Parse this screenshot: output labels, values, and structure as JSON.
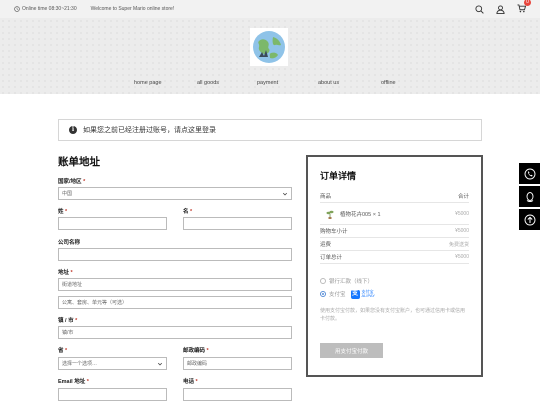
{
  "topbar": {
    "online_time": "Online time 08:30~21:30",
    "welcome": "Welcome to Super Mario online store!",
    "cart_count": "0"
  },
  "nav": {
    "home": "home page",
    "goods": "all goods",
    "payment": "payment",
    "about": "about us",
    "offline": "offline"
  },
  "notice": {
    "text": "如果您之前已经注册过账号，请点这里登录"
  },
  "billing": {
    "title": "账单地址",
    "country_label": "国家/地区",
    "country_value": "中国",
    "last_name_label": "姓",
    "first_name_label": "名",
    "company_label": "公司名称",
    "address_label": "地址",
    "address1_placeholder": "街道地址",
    "address2_placeholder": "公寓、套房、单元等（可选）",
    "city_label": "镇 / 市",
    "city_placeholder": "镇/市",
    "state_label": "省",
    "state_value": "选择一个选项…",
    "postcode_label": "邮政编码",
    "postcode_placeholder": "邮政编码",
    "email_label": "Email 地址",
    "phone_label": "电话",
    "required_mark": "*"
  },
  "order": {
    "title": "订单详情",
    "col_product": "商品",
    "col_total": "合计",
    "product_name": "植物花卉005 × 1",
    "product_price": "¥5000",
    "subtotal_label": "购物车小计",
    "subtotal_value": "¥5000",
    "shipping_label": "运费",
    "shipping_value": "免费送货",
    "total_label": "订单总计",
    "total_value": "¥5000",
    "pay_bank": "银行汇款（线下）",
    "pay_alipay": "支付宝",
    "alipay_logo_line1": "支付宝",
    "alipay_logo_line2": "ALIPAY",
    "alipay_desc": "使用支付宝付款，如果您没有支付宝账户，也可通过信用卡或信用卡付款。",
    "pay_button": "用支付宝付款"
  }
}
